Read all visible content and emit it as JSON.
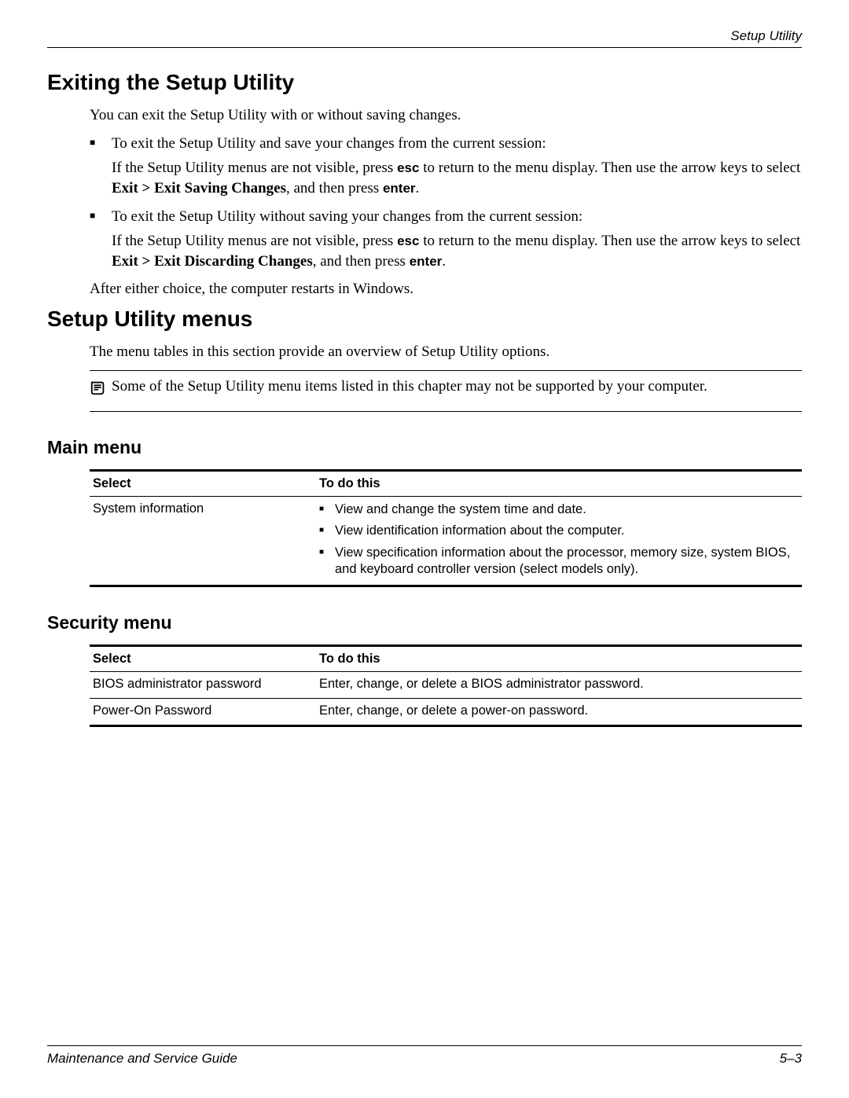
{
  "header": {
    "section": "Setup Utility"
  },
  "exiting": {
    "heading": "Exiting the Setup Utility",
    "intro": "You can exit the Setup Utility with or without saving changes.",
    "bullets": [
      {
        "lead": "To exit the Setup Utility and save your changes from the current session:",
        "detail_pre": "If the Setup Utility menus are not visible, press ",
        "detail_kbd1": "esc",
        "detail_mid": " to return to the menu display. Then use the arrow keys to select ",
        "detail_bold": "Exit > Exit Saving Changes",
        "detail_post": ", and then press ",
        "detail_kbd2": "enter",
        "detail_end": "."
      },
      {
        "lead": "To exit the Setup Utility without saving your changes from the current session:",
        "detail_pre": "If the Setup Utility menus are not visible, press ",
        "detail_kbd1": "esc",
        "detail_mid": " to return to the menu display. Then use the arrow keys to select ",
        "detail_bold": "Exit > Exit Discarding Changes",
        "detail_post": ", and then press ",
        "detail_kbd2": "enter",
        "detail_end": "."
      }
    ],
    "after": "After either choice, the computer restarts in Windows."
  },
  "menus": {
    "heading": "Setup Utility menus",
    "intro": "The menu tables in this section provide an overview of Setup Utility options.",
    "note": "Some of the Setup Utility menu items listed in this chapter may not be supported by your computer."
  },
  "main_menu": {
    "heading": "Main menu",
    "columns": {
      "select": "Select",
      "todo": "To do this"
    },
    "rows": [
      {
        "select": "System information",
        "items": [
          "View and change the system time and date.",
          "View identification information about the computer.",
          "View specification information about the processor, memory size, system BIOS, and keyboard controller version (select models only)."
        ]
      }
    ]
  },
  "security_menu": {
    "heading": "Security menu",
    "columns": {
      "select": "Select",
      "todo": "To do this"
    },
    "rows": [
      {
        "select": "BIOS administrator password",
        "desc": "Enter, change, or delete a BIOS administrator password."
      },
      {
        "select": "Power-On Password",
        "desc": "Enter, change, or delete a power-on password."
      }
    ]
  },
  "footer": {
    "left": "Maintenance and Service Guide",
    "right": "5–3"
  }
}
